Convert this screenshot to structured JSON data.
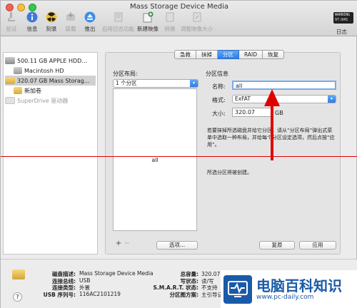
{
  "window": {
    "title": "Mass Storage Device Media"
  },
  "toolbar": {
    "verify": "验证",
    "info": "信息",
    "burn": "刻录",
    "mount": "装载",
    "eject": "推出",
    "enable_journaling": "启用日志功能",
    "new_image": "新建映像",
    "convert": "转换",
    "resize_image": "调整映像大小",
    "log": "日志",
    "log_display": "WARNING\n97:84S"
  },
  "sidebar": {
    "items": [
      {
        "label": "500.11 GB APPLE HDD..."
      },
      {
        "label": "Macintosh HD"
      },
      {
        "label": "320.07 GB Mass Storag..."
      },
      {
        "label": "新加卷"
      },
      {
        "label": "SuperDrive 驱动器"
      }
    ]
  },
  "tabs": [
    "急救",
    "抹掉",
    "分区",
    "RAID",
    "恢复"
  ],
  "active_tab": "分区",
  "partition_layout": {
    "heading": "分区布局:",
    "selected": "1 个分区",
    "partition_name": "all",
    "options_button": "选项..."
  },
  "partition_info": {
    "heading": "分区信息",
    "name_label": "名称:",
    "name_value": "all",
    "format_label": "格式:",
    "format_value": "ExFAT",
    "size_label": "大小:",
    "size_value": "320.07",
    "size_unit": "GB",
    "help_text": "若要抹掉所选磁盘并给它分区，请从“分区布局”弹出式菜单中选取一种布局，并给每个分区设定选项，然后点按“应用”。",
    "status_text": "所选分区将被创建。",
    "revert_button": "复原",
    "apply_button": "应用"
  },
  "footer": {
    "disk_desc_label": "磁盘描述:",
    "disk_desc_value": "Mass Storage Device Media",
    "bus_label": "连接总线:",
    "bus_value": "USB",
    "conn_type_label": "连接类型:",
    "conn_type_value": "外置",
    "serial_label": "USB 序列号:",
    "serial_value": "116AC2101219",
    "capacity_label": "总容量:",
    "capacity_value": "320.07 GB (320,072,932,352 字节)",
    "write_status_label": "写状态:",
    "write_status_value": "读/写",
    "smart_label": "S.M.A.R.T. 状态:",
    "smart_value": "不支持",
    "scheme_label": "分区图方案:",
    "scheme_value": "主引导记录"
  },
  "watermark": {
    "title": "电脑百科知识",
    "url": "www.pc-daily.com"
  },
  "colors": {
    "accent": "#2e7ee8",
    "annotation": "#e00000"
  }
}
